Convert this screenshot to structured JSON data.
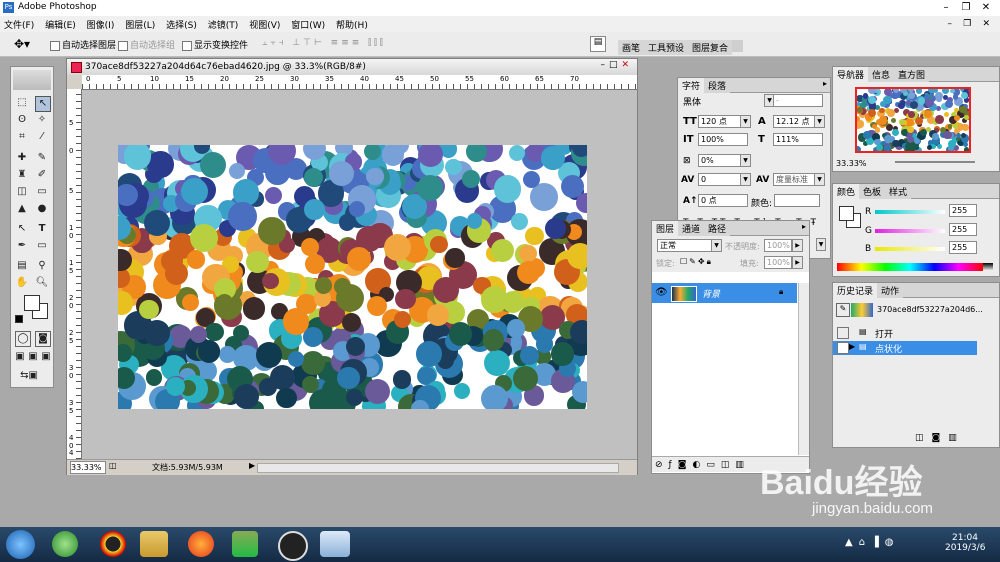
{
  "app": {
    "title": "Adobe Photoshop"
  },
  "menu": [
    "文件(F)",
    "编辑(E)",
    "图像(I)",
    "图层(L)",
    "选择(S)",
    "滤镜(T)",
    "视图(V)",
    "窗口(W)",
    "帮助(H)"
  ],
  "options": {
    "auto_select_layer": "自动选择图层",
    "auto_select_group": "自动选择组",
    "show_transform": "显示变换控件"
  },
  "palette_well": [
    "画笔",
    "工具预设",
    "图层复合"
  ],
  "document": {
    "title": "370ace8df53227a204d64c76ebad4620.jpg @ 33.3%(RGB/8#)",
    "zoom": "33.33%",
    "doc_info": "文档:5.93M/5.93M",
    "ruler_top": [
      "0",
      "5",
      "10",
      "15",
      "20",
      "25",
      "30",
      "35",
      "40",
      "45",
      "50",
      "55",
      "60",
      "65",
      "70"
    ],
    "ruler_left": [
      "5",
      "0",
      "5",
      "1",
      "0",
      "1",
      "5",
      "2",
      "0",
      "2",
      "5",
      "3",
      "0",
      "3",
      "5",
      "4",
      "0",
      "4",
      "5"
    ]
  },
  "character": {
    "tabs": [
      "字符",
      "段落"
    ],
    "font": "黑体",
    "style": "-",
    "size": "120 点",
    "leading": "12.12 点",
    "vscale": "100%",
    "hscale": "111%",
    "tracking_kerning": "0%",
    "tracking": "0",
    "tracking_unit": "度量标准",
    "baseline": "0 点",
    "color_label": "颜色:"
  },
  "layers": {
    "tabs": [
      "图层",
      "通道",
      "路径"
    ],
    "blend": "正常",
    "opacity_label": "不透明度:",
    "opacity": "100%",
    "lock_label": "锁定:",
    "fill_label": "填充:",
    "fill": "100%",
    "layer_name": "背景"
  },
  "navigator": {
    "tabs": [
      "导航器",
      "信息",
      "直方图"
    ],
    "zoom": "33.33%"
  },
  "color": {
    "tabs": [
      "颜色",
      "色板",
      "样式"
    ],
    "r_label": "R",
    "g_label": "G",
    "b_label": "B",
    "r": "255",
    "g": "255",
    "b": "255",
    "r_color": "#00c8c8",
    "g_color": "#e020e0",
    "b_color": "#e8e800"
  },
  "history": {
    "tabs": [
      "历史记录",
      "动作"
    ],
    "snapshot": "370ace8df53227a204d6...",
    "items": [
      "打开",
      "点状化"
    ]
  },
  "taskbar": {
    "time": "21:04",
    "date": "2019/3/6"
  },
  "watermark": {
    "text": "Baidu经验",
    "url": "jingyan.baidu.com"
  }
}
